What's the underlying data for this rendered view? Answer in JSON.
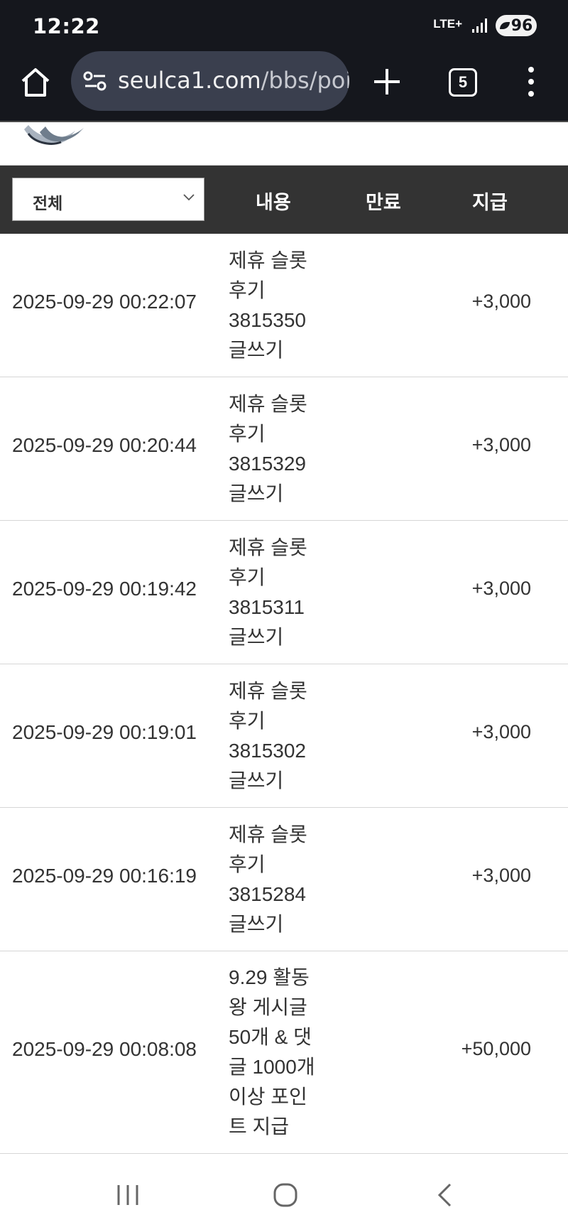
{
  "status_bar": {
    "time": "12:22",
    "network": "LTE+",
    "battery": "96"
  },
  "browser": {
    "url_host": "seulca1.com",
    "url_path": "/bbs/poi",
    "tab_count": "5"
  },
  "table": {
    "filter_value": "전체",
    "headers": {
      "content": "내용",
      "expire": "만료",
      "pay": "지급"
    },
    "rows": [
      {
        "date": "2025-09-29 00:22:07",
        "content": "제휴 슬롯\n후기\n3815350\n글쓰기",
        "expire": "",
        "amount": "+3,000"
      },
      {
        "date": "2025-09-29 00:20:44",
        "content": "제휴 슬롯\n후기\n3815329\n글쓰기",
        "expire": "",
        "amount": "+3,000"
      },
      {
        "date": "2025-09-29 00:19:42",
        "content": "제휴 슬롯\n후기\n3815311\n글쓰기",
        "expire": "",
        "amount": "+3,000"
      },
      {
        "date": "2025-09-29 00:19:01",
        "content": "제휴 슬롯\n후기\n3815302\n글쓰기",
        "expire": "",
        "amount": "+3,000"
      },
      {
        "date": "2025-09-29 00:16:19",
        "content": "제휴 슬롯\n후기\n3815284\n글쓰기",
        "expire": "",
        "amount": "+3,000"
      },
      {
        "date": "2025-09-29 00:08:08",
        "content": "9.29 활동\n왕 게시글\n50개 & 댓\n글 1000개\n이상 포인\n트 지급",
        "expire": "",
        "amount": "+50,000"
      }
    ]
  },
  "icons": {
    "home": "home-icon",
    "site_settings": "tune-icon",
    "new_tab": "plus-icon",
    "menu": "more-vert-icon",
    "select_arrow": "chevron-down-icon"
  }
}
